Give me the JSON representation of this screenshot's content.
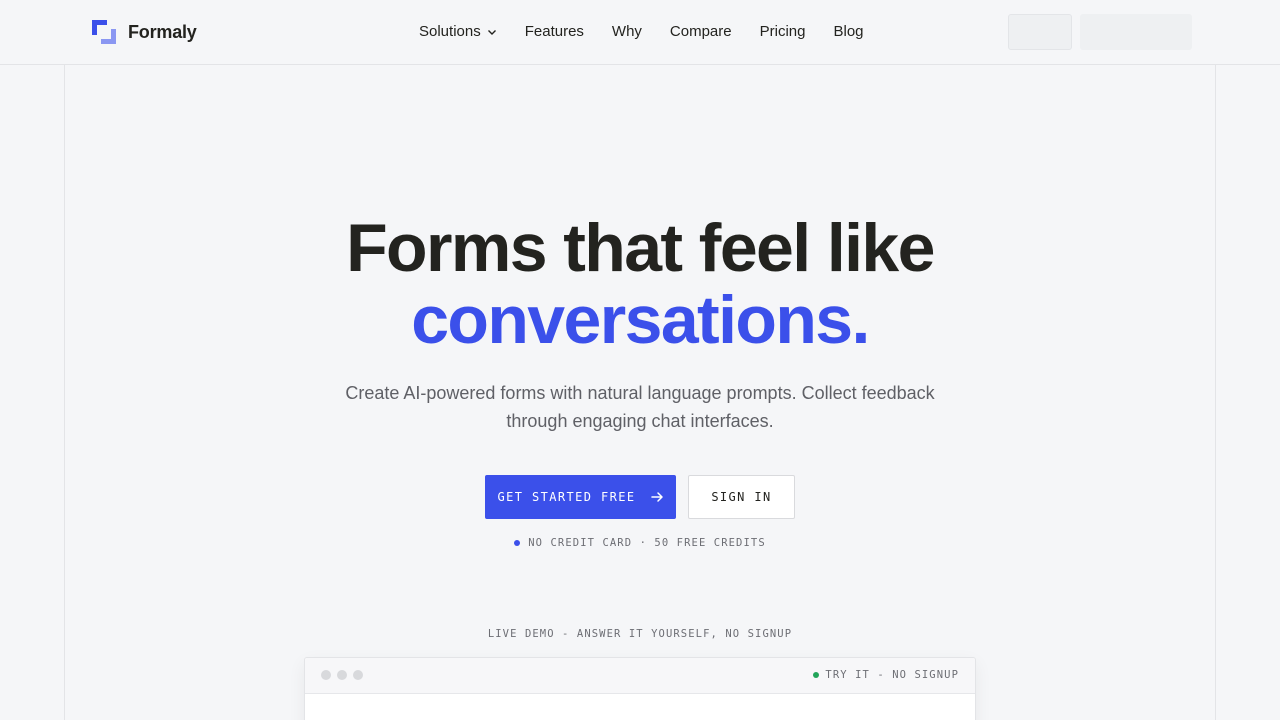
{
  "brand": {
    "name": "Formaly",
    "accent": "#3b50ea"
  },
  "nav": {
    "items": [
      {
        "label": "Solutions",
        "has_dropdown": true
      },
      {
        "label": "Features"
      },
      {
        "label": "Why"
      },
      {
        "label": "Compare"
      },
      {
        "label": "Pricing"
      },
      {
        "label": "Blog"
      }
    ]
  },
  "hero": {
    "title_line1": "Forms that feel like",
    "title_line2": "conversations.",
    "subtitle": "Create AI-powered forms with natural language prompts. Collect feedback through engaging chat interfaces.",
    "cta_label": "GET STARTED FREE",
    "signin_label": "SIGN IN",
    "note": "NO CREDIT CARD · 50 FREE CREDITS"
  },
  "demo": {
    "label": "LIVE DEMO - ANSWER IT YOURSELF, NO SIGNUP",
    "badge": "TRY IT - NO SIGNUP"
  }
}
